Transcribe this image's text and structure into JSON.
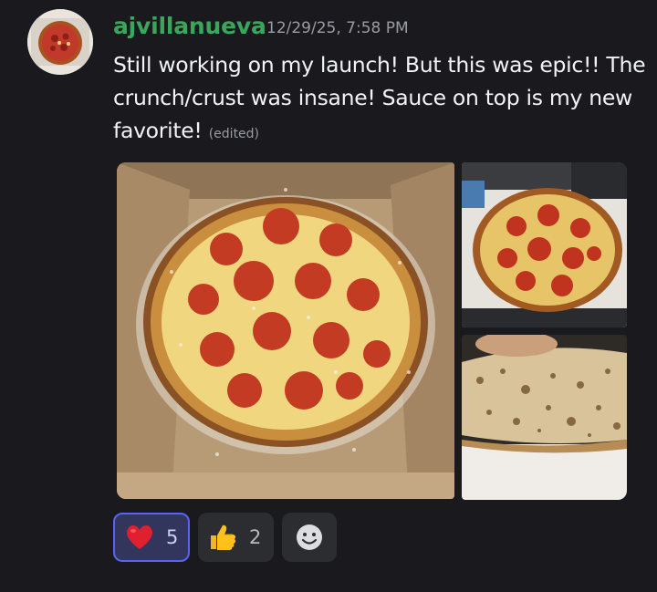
{
  "message": {
    "username": "ajvillanueva",
    "timestamp": "12/29/25, 7:58 PM",
    "text": "Still working on my launch! But this was epic!! The crunch/crust was insane! Sauce on top is my new favorite!",
    "edited_label": "(edited)"
  },
  "attachments": [
    {
      "name": "pizza-in-box-photo"
    },
    {
      "name": "pizza-on-board-photo"
    },
    {
      "name": "crust-underside-photo"
    }
  ],
  "reactions": [
    {
      "emoji": "heart",
      "count": "5",
      "active": true
    },
    {
      "emoji": "thumbs-up",
      "count": "2",
      "active": false
    }
  ],
  "colors": {
    "background": "#1a1a1e",
    "username": "#3ba55c",
    "timestamp": "#9a9ba3",
    "active_reaction_border": "#5865f2"
  }
}
